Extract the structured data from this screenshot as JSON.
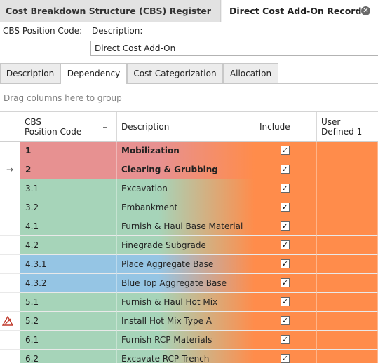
{
  "doc_tabs": [
    {
      "label": "Cost Breakdown Structure (CBS) Register"
    },
    {
      "label": "Direct Cost Add-On Record"
    }
  ],
  "close_glyph": "✕",
  "fields": {
    "position_code_label": "CBS Position Code:",
    "description_label": "Description:",
    "description_value": "Direct Cost Add-On"
  },
  "sub_tabs": [
    {
      "label": "Description",
      "active": false
    },
    {
      "label": "Dependency",
      "active": true
    },
    {
      "label": "Cost Categorization",
      "active": false
    },
    {
      "label": "Allocation",
      "active": false
    }
  ],
  "group_hint": "Drag columns here to group",
  "columns": {
    "code": [
      "CBS",
      "Position Code"
    ],
    "description": "Description",
    "include": "Include",
    "user_defined": [
      "User",
      "Defined 1"
    ]
  },
  "colors": {
    "red": "#e79191",
    "green": "#a6d4b9",
    "blue": "#95c5e4",
    "orange": "#ff8c4b"
  },
  "rows": [
    {
      "code": "1",
      "description": "Mobilization",
      "include": true,
      "color": "red",
      "bold": true,
      "indicator": ""
    },
    {
      "code": "2",
      "description": "Clearing & Grubbing",
      "include": true,
      "color": "red",
      "bold": true,
      "indicator": "→"
    },
    {
      "code": "3.1",
      "description": "Excavation",
      "include": true,
      "color": "green",
      "bold": false,
      "indicator": ""
    },
    {
      "code": "3.2",
      "description": "Embankment",
      "include": true,
      "color": "green",
      "bold": false,
      "indicator": ""
    },
    {
      "code": "4.1",
      "description": "Furnish & Haul Base Material",
      "include": true,
      "color": "green",
      "bold": false,
      "indicator": ""
    },
    {
      "code": "4.2",
      "description": "Finegrade Subgrade",
      "include": true,
      "color": "green",
      "bold": false,
      "indicator": ""
    },
    {
      "code": "4.3.1",
      "description": "Place Aggregate Base",
      "include": true,
      "color": "blue",
      "bold": false,
      "indicator": ""
    },
    {
      "code": "4.3.2",
      "description": "Blue Top Aggregate Base",
      "include": true,
      "color": "blue",
      "bold": false,
      "indicator": ""
    },
    {
      "code": "5.1",
      "description": "Furnish & Haul Hot Mix",
      "include": true,
      "color": "green",
      "bold": false,
      "indicator": ""
    },
    {
      "code": "5.2",
      "description": "Install Hot Mix Type A",
      "include": true,
      "color": "green",
      "bold": false,
      "indicator": "warning"
    },
    {
      "code": "6.1",
      "description": "Furnish RCP Materials",
      "include": true,
      "color": "green",
      "bold": false,
      "indicator": ""
    },
    {
      "code": "6.2",
      "description": "Excavate RCP Trench",
      "include": true,
      "color": "green",
      "bold": false,
      "indicator": ""
    }
  ],
  "check_glyph": "✓"
}
